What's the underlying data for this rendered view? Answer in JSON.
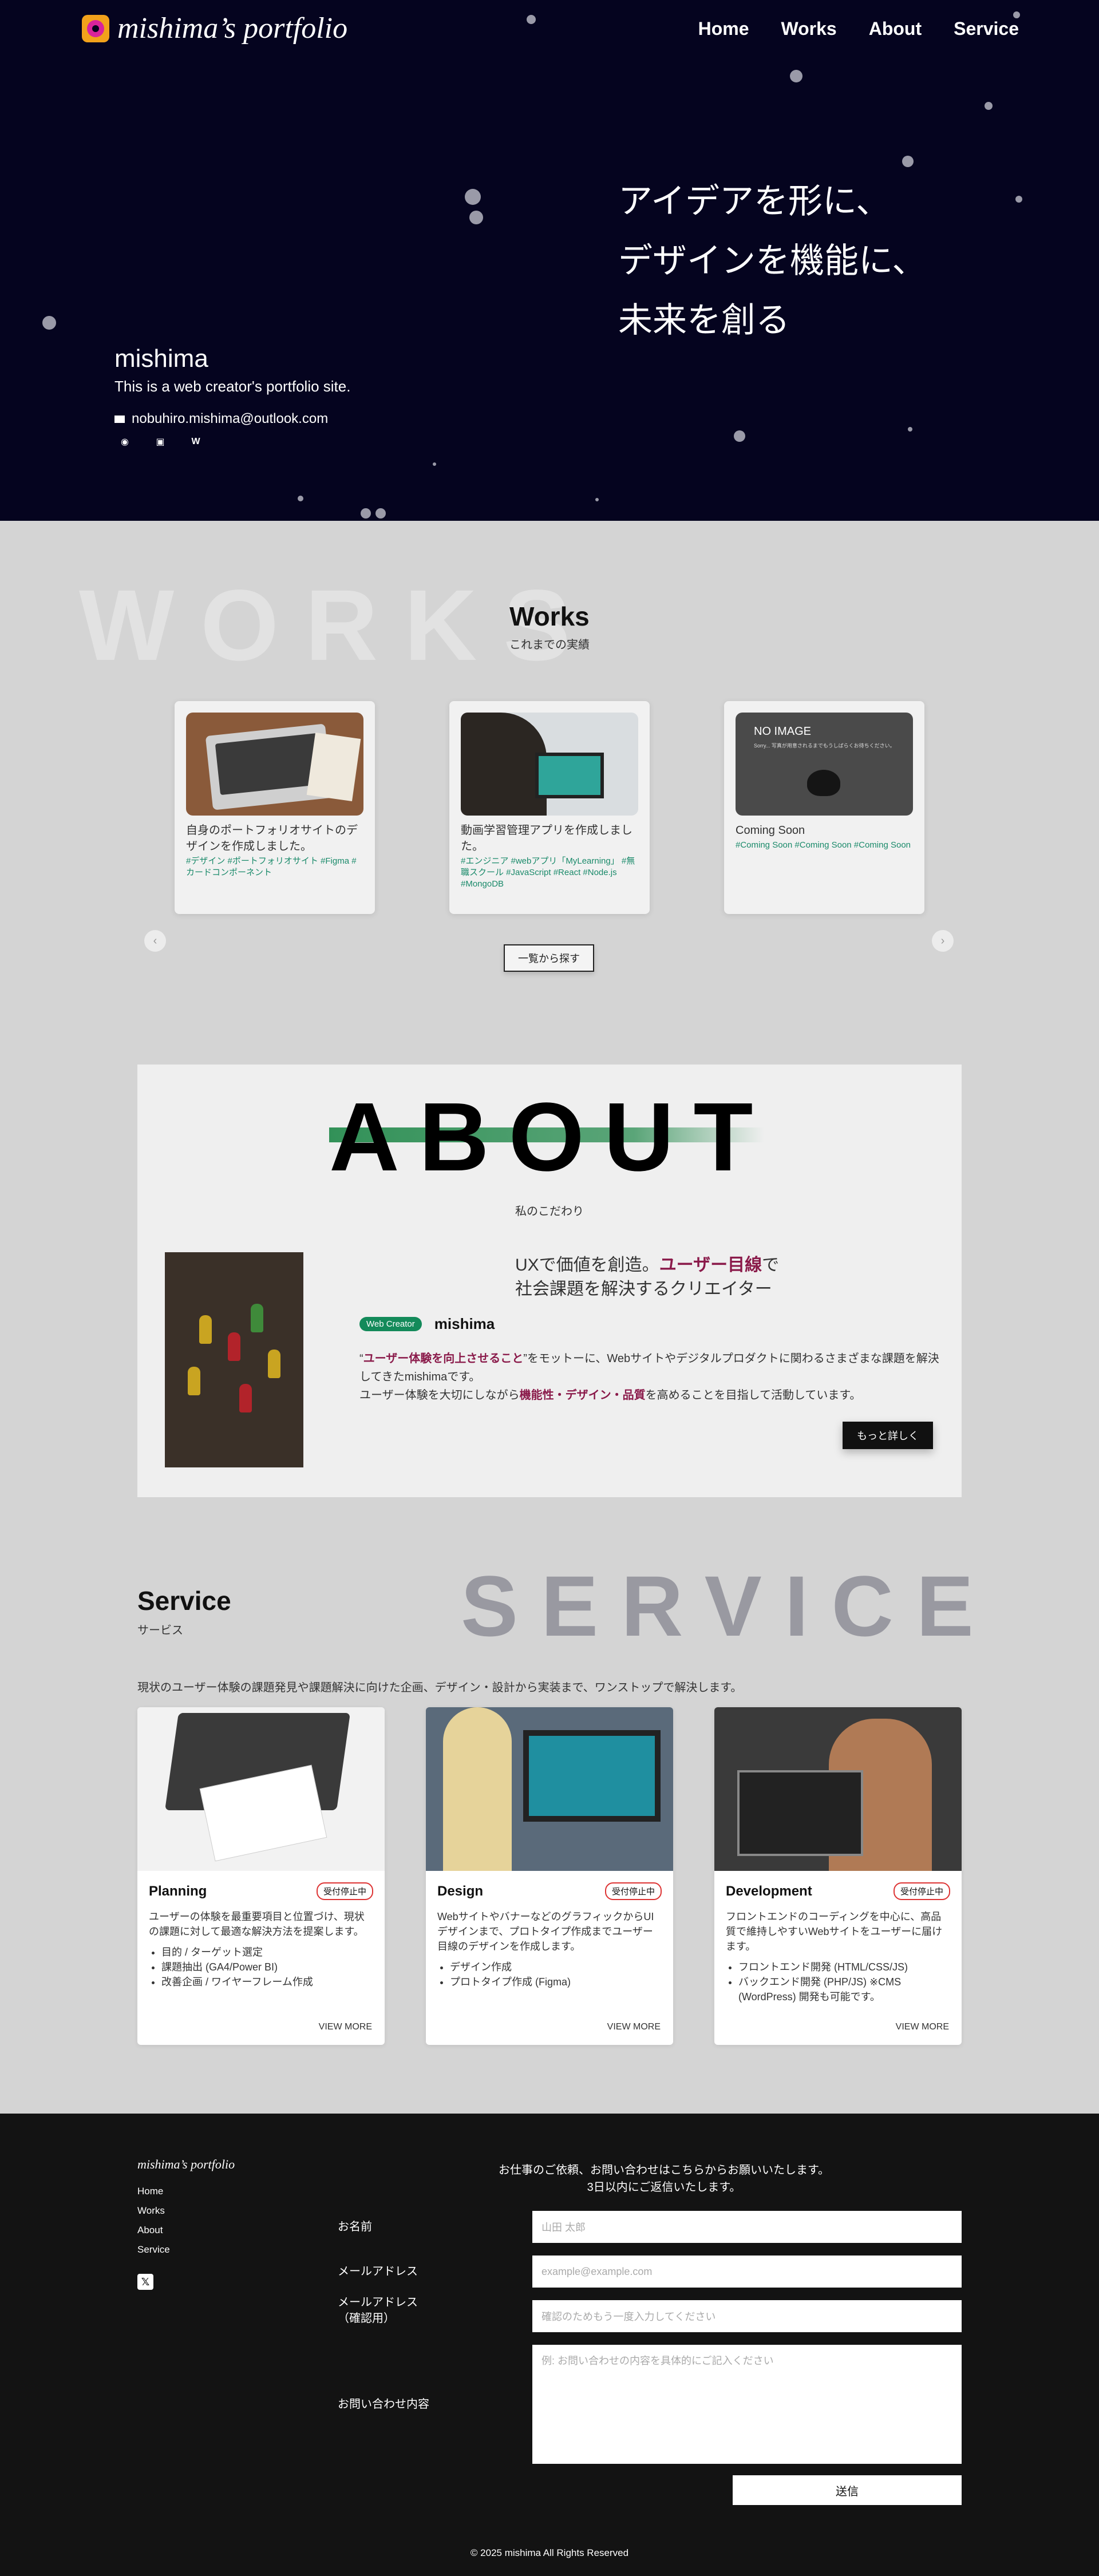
{
  "header": {
    "logo_text": "mishima’s portfolio",
    "nav": [
      "Home",
      "Works",
      "About",
      "Service"
    ]
  },
  "hero": {
    "tagline": [
      "アイデアを形に、",
      "デザインを機能に、",
      "未来を創る"
    ],
    "name": "mishima",
    "subtitle": "This is a web creator's portfolio site.",
    "email": "nobuhiro.mishima@outlook.com",
    "social_icons": [
      "github-icon",
      "linkedin-icon",
      "wantedly-icon"
    ]
  },
  "works": {
    "bg_text": "WORKS",
    "title": "Works",
    "subtitle": "これまでの実績",
    "cards": [
      {
        "title": "自身のポートフォリオサイトのデザインを作成しました。",
        "tags": "#デザイン #ポートフォリオサイト #Figma #カードコンポーネント"
      },
      {
        "title": "動画学習管理アプリを作成しました。",
        "tags": "#エンジニア #webアプリ「MyLearning」 #無職スクール #JavaScript #React #Node.js #MongoDB"
      },
      {
        "title": "Coming Soon",
        "tags": "#Coming Soon #Coming Soon #Coming Soon",
        "thumb_label": "NO IMAGE",
        "thumb_note": "Sorry... 写真が用意されるまでもうしばらくお待ちください。"
      }
    ],
    "prev_label": "‹",
    "next_label": "›",
    "more_button": "一覧から探す"
  },
  "about": {
    "bg_text": "ABOUT",
    "subtitle": "私のこだわり",
    "headline_pre": "UXで価値を創造。",
    "headline_highlight": "ユーザー目線",
    "headline_post": "で",
    "headline_line2": "社会課題を解決するクリエイター",
    "badge": "Web Creator",
    "name": "mishima",
    "body_1a": "“",
    "body_1_highlight": "ユーザー体験を向上させること",
    "body_1b": "”をモットーに、Webサイトやデジタルプロダクトに関わるさまざまな課題を解決してきたmishimaです。",
    "body_2a": "ユーザー体験を大切にしながら",
    "body_2_highlight": "機能性・デザイン・品質",
    "body_2b": "を高めることを目指して活動しています。",
    "button": "もっと詳しく"
  },
  "service": {
    "title": "Service",
    "subtitle": "サービス",
    "bg_text": "SERVICE",
    "lead": "現状のユーザー体験の課題発見や課題解決に向けた企画、デザイン・設計から実装まで、ワンストップで解決します。",
    "cards": [
      {
        "name": "Planning",
        "badge": "受付停止中",
        "desc": "ユーザーの体験を最重要項目と位置づけ、現状の課題に対して最適な解決方法を提案します。",
        "items": [
          "目的 / ターゲット選定",
          "課題抽出 (GA4/Power BI)",
          "改善企画 / ワイヤーフレーム作成"
        ],
        "more": "VIEW MORE"
      },
      {
        "name": "Design",
        "badge": "受付停止中",
        "desc": "WebサイトやバナーなどのグラフィックからUIデザインまで、プロトタイプ作成までユーザー目線のデザインを作成します。",
        "items": [
          "デザイン作成",
          "プロトタイプ作成 (Figma)"
        ],
        "more": "VIEW MORE"
      },
      {
        "name": "Development",
        "badge": "受付停止中",
        "desc": "フロントエンドのコーディングを中心に、高品質で維持しやすいWebサイトをユーザーに届けます。",
        "items": [
          "フロントエンド開発 (HTML/CSS/JS)",
          "バックエンド開発 (PHP/JS) ※CMS (WordPress) 開発も可能です。"
        ],
        "more": "VIEW MORE"
      }
    ]
  },
  "footer": {
    "logo_text": "mishima’s portfolio",
    "links": [
      "Home",
      "Works",
      "About",
      "Service"
    ],
    "x_icon": "x-icon",
    "intro_line1": "お仕事のご依頼、お問い合わせはこちらからお願いいたします。",
    "intro_line2": "3日以内にご返信いたします。",
    "form": {
      "name_label": "お名前",
      "name_placeholder": "山田 太郎",
      "email_label": "メールアドレス",
      "email_placeholder": "example@example.com",
      "confirm_label_1": "メールアドレス",
      "confirm_label_2": "（確認用）",
      "confirm_placeholder": "確認のためもう一度入力してください",
      "message_label": "お問い合わせ内容",
      "message_placeholder": "例: お問い合わせの内容を具体的にご記入ください",
      "submit": "送信"
    },
    "copyright": "© 2025 mishima All Rights Reserved"
  }
}
